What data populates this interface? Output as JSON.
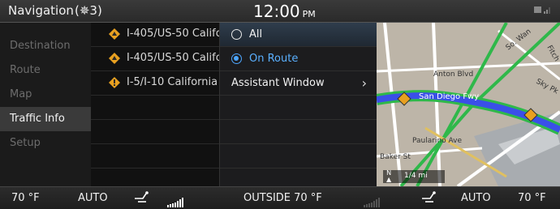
{
  "header": {
    "title": "Navigation",
    "nav_count": "(✵3)",
    "clock": "12:00",
    "clock_suffix": "PM",
    "status_text": "Ṻт · T"
  },
  "menu": {
    "items": [
      {
        "label": "Destination",
        "active": false
      },
      {
        "label": "Route",
        "active": false
      },
      {
        "label": "Map",
        "active": false
      },
      {
        "label": "Traffic Info",
        "active": true
      },
      {
        "label": "Setup",
        "active": false
      }
    ]
  },
  "traffic_list": {
    "items": [
      {
        "label": "I-405/US-50 California"
      },
      {
        "label": "I-405/US-50 California"
      },
      {
        "label": "I-5/I-10 California"
      }
    ]
  },
  "popup": {
    "options": [
      {
        "label": "All",
        "selected": false
      },
      {
        "label": "On Route",
        "selected": true
      }
    ],
    "assistant_window": "Assistant Window"
  },
  "map": {
    "streets": [
      "Anton Blvd",
      "San Diego Fwy",
      "Paularino Ave",
      "Baker St",
      "So. Wan",
      "Sky Pk",
      "Fitch"
    ],
    "scale_label": "1/4 mi",
    "north_label": "N"
  },
  "bottom": {
    "temp_left": "70 °F",
    "mode_left": "AUTO",
    "outside": "OUTSIDE  70 °F",
    "mode_right": "AUTO",
    "temp_right": "70 °F"
  },
  "colors": {
    "accent_blue": "#4da6ff",
    "warning_orange": "#e8a020",
    "route_blue": "#3a4fe8",
    "route_green": "#2fb84a"
  }
}
